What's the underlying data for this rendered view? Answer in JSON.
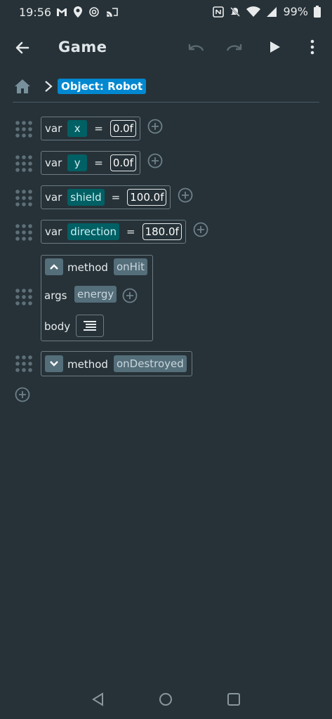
{
  "status_bar": {
    "time": "19:56",
    "battery": "99%"
  },
  "app_bar": {
    "title": "Game"
  },
  "breadcrumb": {
    "object_label": "Object: Robot"
  },
  "variables": [
    {
      "keyword": "var",
      "name": "x",
      "equals": "=",
      "value": "0.0f"
    },
    {
      "keyword": "var",
      "name": "y",
      "equals": "=",
      "value": "0.0f"
    },
    {
      "keyword": "var",
      "name": "shield",
      "equals": "=",
      "value": "100.0f"
    },
    {
      "keyword": "var",
      "name": "direction",
      "equals": "=",
      "value": "180.0f"
    }
  ],
  "methods": [
    {
      "keyword": "method",
      "name": "onHit",
      "expanded": true,
      "args_label": "args",
      "args": [
        "energy"
      ],
      "body_label": "body"
    },
    {
      "keyword": "method",
      "name": "onDestroyed",
      "expanded": false
    }
  ],
  "icons": {
    "back": "arrow-left-icon",
    "undo": "undo-icon",
    "redo": "redo-icon",
    "run": "play-icon",
    "more": "more-vert-icon",
    "home": "home-icon",
    "add": "add-circle-icon",
    "drag": "drag-handle-icon",
    "body": "code-block-icon"
  },
  "colors": {
    "background": "#263238",
    "name_chip": "#006064",
    "method_chip": "#546e7a",
    "object_chip": "#0288d1"
  }
}
